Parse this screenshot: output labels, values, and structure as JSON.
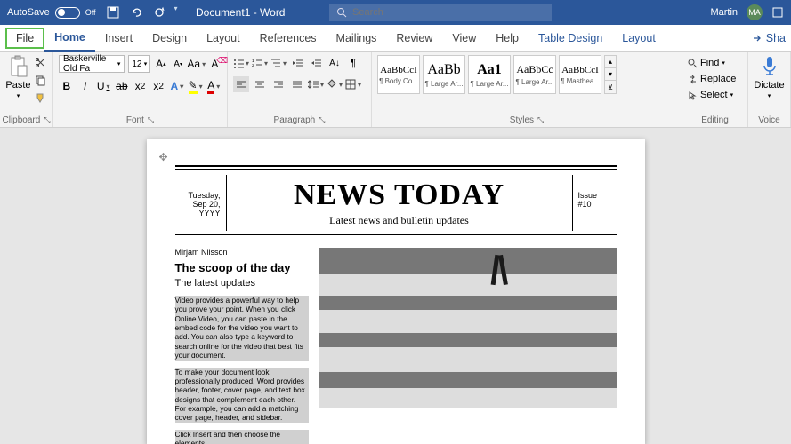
{
  "titlebar": {
    "autosave_label": "AutoSave",
    "autosave_state": "Off",
    "doc_title": "Document1 - Word",
    "search_placeholder": "Search",
    "user_name": "Martin",
    "user_initials": "MA"
  },
  "tabs": {
    "items": [
      "File",
      "Home",
      "Insert",
      "Design",
      "Layout",
      "References",
      "Mailings",
      "Review",
      "View",
      "Help",
      "Table Design",
      "Layout"
    ],
    "active": "Home",
    "share": "Sha"
  },
  "ribbon": {
    "clipboard": {
      "paste": "Paste",
      "label": "Clipboard"
    },
    "font": {
      "name": "Baskerville Old Fa",
      "size": "12",
      "label": "Font"
    },
    "paragraph": {
      "label": "Paragraph"
    },
    "styles": {
      "label": "Styles",
      "items": [
        {
          "preview": "AaBbCcI",
          "name": "¶ Body Co...",
          "fs": "11",
          "fw": "normal"
        },
        {
          "preview": "AaBb",
          "name": "¶ Large Ar...",
          "fs": "16",
          "fw": "normal"
        },
        {
          "preview": "Aa1",
          "name": "¶ Large Ar...",
          "fs": "16",
          "fw": "900"
        },
        {
          "preview": "AaBbCc",
          "name": "¶ Large Ar...",
          "fs": "12",
          "fw": "normal"
        },
        {
          "preview": "AaBbCcI",
          "name": "¶ Masthea...",
          "fs": "11",
          "fw": "normal"
        }
      ]
    },
    "editing": {
      "find": "Find",
      "replace": "Replace",
      "select": "Select",
      "label": "Editing"
    },
    "voice": {
      "dictate": "Dictate",
      "label": "Voice"
    }
  },
  "doc": {
    "date": [
      "Tuesday,",
      "Sep 20,",
      "YYYY"
    ],
    "title": "NEWS TODAY",
    "subtitle": "Latest news and bulletin updates",
    "issue": [
      "Issue",
      "#10"
    ],
    "byline": "Mirjam Nilsson",
    "headline": "The scoop of the day",
    "deck": "The latest updates",
    "p1": "Video provides a powerful way to help you prove your point. When you click Online Video, you can paste in the embed code for the video you want to add. You can also type a keyword to search online for the video that best fits your document.",
    "p2": "To make your document look professionally produced, Word provides header, footer, cover page, and text box designs that complement each other. For example, you can add a matching cover page, header, and sidebar.",
    "p3": "Click Insert and then choose the elements"
  }
}
